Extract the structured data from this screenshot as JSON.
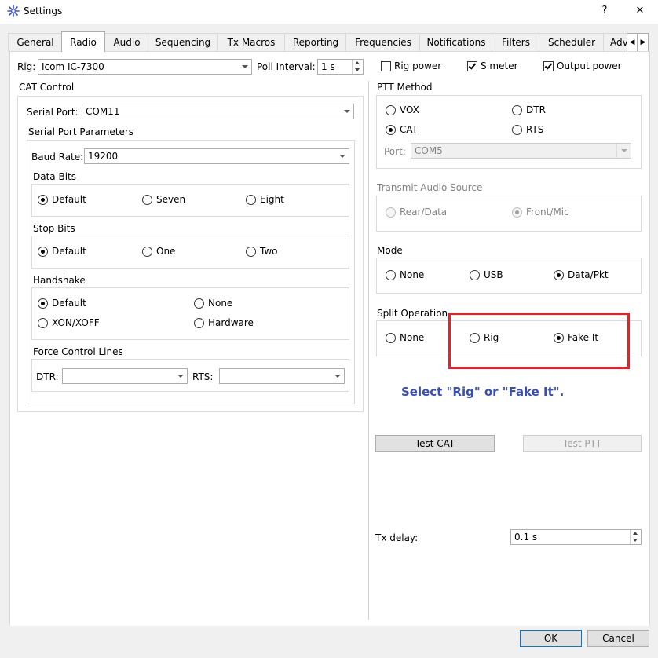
{
  "window": {
    "title": "Settings",
    "help_label": "?",
    "close_label": "✕",
    "icon": "starburst-app-icon"
  },
  "tabs": [
    {
      "label": "General"
    },
    {
      "label": "Radio"
    },
    {
      "label": "Audio"
    },
    {
      "label": "Sequencing"
    },
    {
      "label": "Tx Macros"
    },
    {
      "label": "Reporting"
    },
    {
      "label": "Frequencies"
    },
    {
      "label": "Notifications"
    },
    {
      "label": "Filters"
    },
    {
      "label": "Scheduler"
    },
    {
      "label": "Adv"
    }
  ],
  "active_tab": "Radio",
  "top_row": {
    "rig_label": "Rig:",
    "rig_value": "Icom IC-7300",
    "poll_label": "Poll Interval:",
    "poll_value": "1 s",
    "rig_power_label": "Rig power",
    "rig_power_checked": false,
    "s_meter_label": "S meter",
    "s_meter_checked": true,
    "output_power_label": "Output power",
    "output_power_checked": true
  },
  "cat_control": {
    "title": "CAT Control",
    "serial_port_label": "Serial Port:",
    "serial_port_value": "COM11",
    "params_title": "Serial Port Parameters",
    "baud_label": "Baud Rate:",
    "baud_value": "19200",
    "data_bits": {
      "title": "Data Bits",
      "options": [
        "Default",
        "Seven",
        "Eight"
      ],
      "selected": "Default"
    },
    "stop_bits": {
      "title": "Stop Bits",
      "options": [
        "Default",
        "One",
        "Two"
      ],
      "selected": "Default"
    },
    "handshake": {
      "title": "Handshake",
      "options": [
        "Default",
        "None",
        "XON/XOFF",
        "Hardware"
      ],
      "selected": "Default"
    },
    "force_lines": {
      "title": "Force Control Lines",
      "dtr_label": "DTR:",
      "dtr_value": "",
      "rts_label": "RTS:",
      "rts_value": ""
    }
  },
  "ptt_method": {
    "title": "PTT Method",
    "options": [
      "VOX",
      "DTR",
      "CAT",
      "RTS"
    ],
    "selected": "CAT",
    "port_label": "Port:",
    "port_value": "COM5"
  },
  "audio_source": {
    "title": "Transmit Audio Source",
    "options": [
      "Rear/Data",
      "Front/Mic"
    ],
    "selected": "Front/Mic"
  },
  "mode": {
    "title": "Mode",
    "options": [
      "None",
      "USB",
      "Data/Pkt"
    ],
    "selected": "Data/Pkt"
  },
  "split": {
    "title": "Split Operation",
    "options": [
      "None",
      "Rig",
      "Fake It"
    ],
    "selected": "Fake It"
  },
  "annotation": "Select \"Rig\" or \"Fake It\".",
  "annotation_color": "#3a4fb5",
  "highlight_color": "#e8202a",
  "buttons": {
    "test_cat": "Test CAT",
    "test_ptt": "Test PTT",
    "ok": "OK",
    "cancel": "Cancel"
  },
  "tx_delay": {
    "label": "Tx delay:",
    "value": "0.1 s"
  }
}
